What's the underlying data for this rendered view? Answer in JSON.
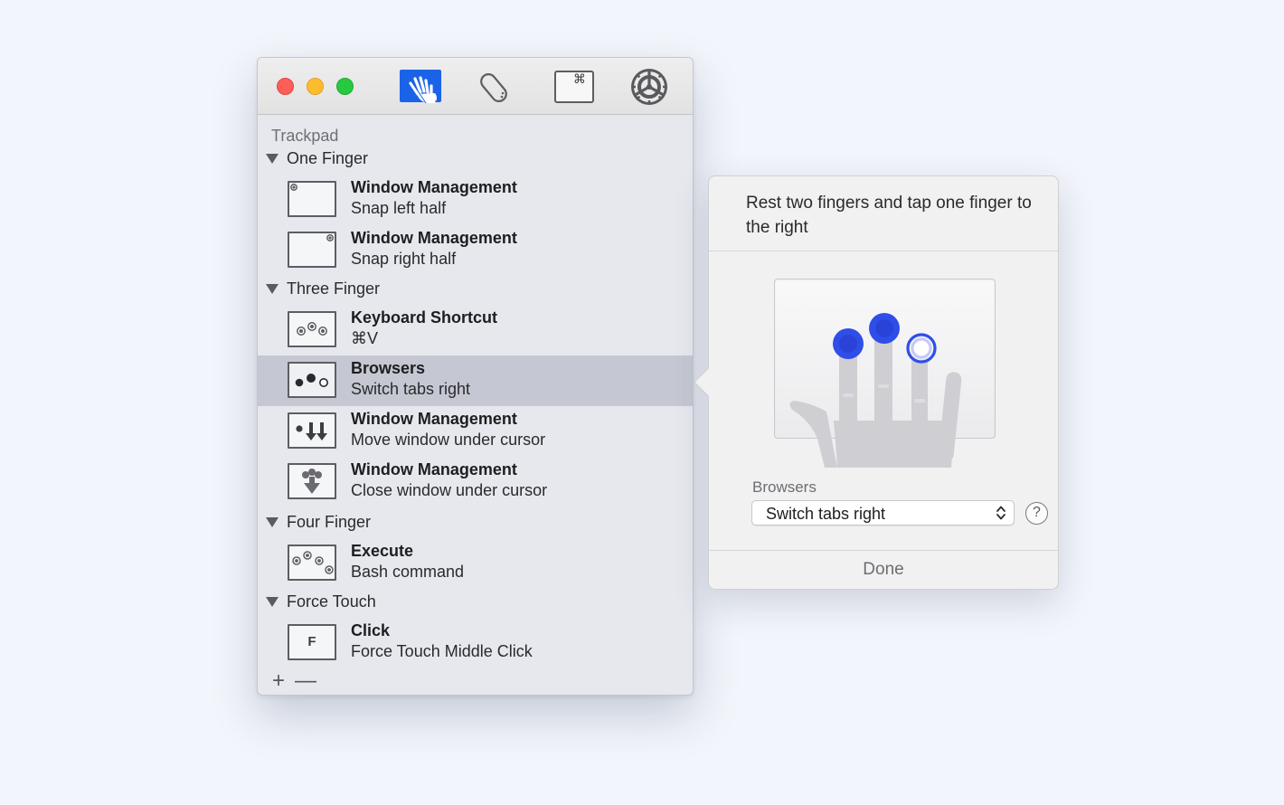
{
  "toolbar": {
    "buttons": [
      {
        "name": "trackpad",
        "icon": "trackpad-hand-icon",
        "active": true
      },
      {
        "name": "mouse",
        "icon": "mouse-icon",
        "active": false
      },
      {
        "name": "keyboard",
        "icon": "command-key-icon",
        "active": false
      },
      {
        "name": "settings",
        "icon": "gear-icon",
        "active": false
      }
    ]
  },
  "list": {
    "section_title": "Trackpad",
    "groups": [
      {
        "label": "One Finger",
        "items": [
          {
            "title": "Window Management",
            "subtitle": "Snap left half",
            "icon": "snap-left-icon"
          },
          {
            "title": "Window Management",
            "subtitle": "Snap right half",
            "icon": "snap-right-icon"
          }
        ]
      },
      {
        "label": "Three Finger",
        "items": [
          {
            "title": "Keyboard Shortcut",
            "subtitle": "⌘V",
            "icon": "three-finger-tap-icon"
          },
          {
            "title": "Browsers",
            "subtitle": "Switch tabs right",
            "icon": "two-finger-tap-right-icon",
            "selected": true
          },
          {
            "title": "Window Management",
            "subtitle": "Move window under cursor",
            "icon": "swipe-down-icon"
          },
          {
            "title": "Window Management",
            "subtitle": "Close window under cursor",
            "icon": "pinch-down-icon"
          }
        ]
      },
      {
        "label": "Four Finger",
        "items": [
          {
            "title": "Execute",
            "subtitle": "Bash command",
            "icon": "four-finger-tap-icon"
          }
        ]
      },
      {
        "label": "Force Touch",
        "items": [
          {
            "title": "Click",
            "subtitle": "Force Touch Middle Click",
            "icon": "force-touch-icon",
            "glyph": "F"
          }
        ]
      }
    ],
    "add_symbol": "+",
    "remove_symbol": "—"
  },
  "popover": {
    "description": "Rest two fingers and tap one finger to the right",
    "field_label": "Browsers",
    "select_value": "Switch tabs right",
    "help_symbol": "?",
    "done_label": "Done"
  },
  "colors": {
    "accent": "#1a63e8",
    "finger_dot": "#2f4ee8",
    "selected_row": "#c5c8d2",
    "close": "#fc5f57",
    "minimize": "#fdbc2e",
    "zoom": "#28c840"
  }
}
